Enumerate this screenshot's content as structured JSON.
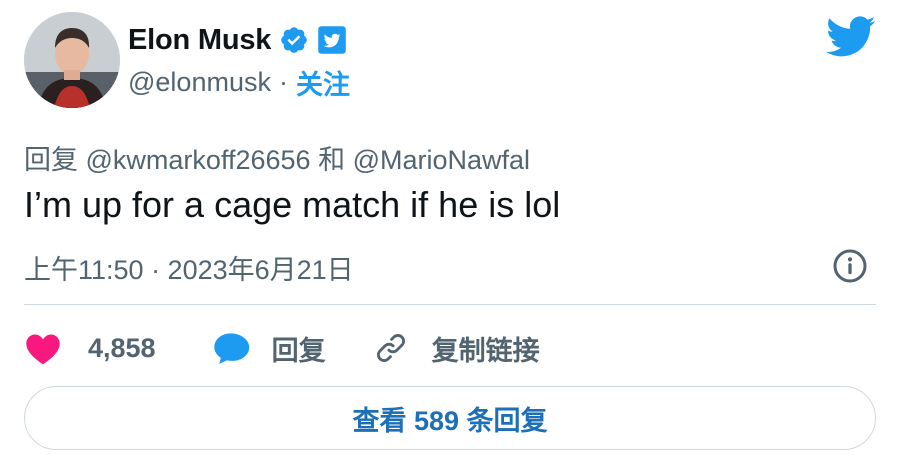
{
  "author": {
    "name": "Elon Musk",
    "handle": "@elonmusk",
    "separator": "·",
    "follow_label": "关注",
    "avatar_icon": "avatar-photo",
    "verified_icon": "verified-badge-icon",
    "affiliate_icon": "twitter-box-icon"
  },
  "brand": {
    "icon": "twitter-bird-icon",
    "color": "#1d9bf0"
  },
  "tweet": {
    "reply_prefix": "回复",
    "reply_to_1": "@kwmarkoff26656",
    "reply_joiner": "和",
    "reply_to_2": "@MarioNawfal",
    "text": "I’m up for a cage match if he is lol",
    "timestamp": "上午11:50 · 2023年6月21日"
  },
  "actions": {
    "like_count": "4,858",
    "reply_label": "回复",
    "copy_link_label": "复制链接",
    "like_color": "#f91880",
    "reply_color": "#1d9bf0"
  },
  "footer": {
    "view_replies_label": "查看 589 条回复"
  }
}
